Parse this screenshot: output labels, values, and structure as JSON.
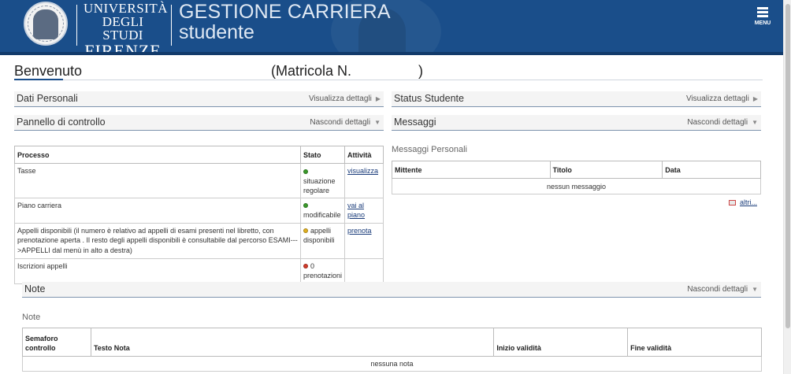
{
  "header": {
    "university_line1": "UNIVERSITÀ",
    "university_line2": "DEGLI STUDI",
    "university_line3": "FIRENZE",
    "app_title_line1": "GESTIONE CARRIERA",
    "app_title_line2": "studente",
    "menu_label": "MENU",
    "seal_text": "FLORENTINA STUDIORUM UNIVERSITAS",
    "colors": {
      "header_bg": "#1a4e8a",
      "text": "#ffffff"
    }
  },
  "welcome": {
    "greeting": "Benvenuto",
    "matricola": "(Matricola N.                 )"
  },
  "sections": {
    "dati_personali": {
      "title": "Dati Personali",
      "action": "Visualizza dettagli",
      "caret": "▶"
    },
    "status_studente": {
      "title": "Status Studente",
      "action": "Visualizza dettagli",
      "caret": "▶"
    },
    "pannello": {
      "title": "Pannello di controllo",
      "action": "Nascondi dettagli",
      "caret": "▼"
    },
    "messaggi": {
      "title": "Messaggi",
      "action": "Nascondi dettagli",
      "caret": "▼"
    },
    "note": {
      "title": "Note",
      "action": "Nascondi dettagli",
      "caret": "▼"
    }
  },
  "process_table": {
    "headers": {
      "processo": "Processo",
      "stato": "Stato",
      "attivita": "Attività"
    },
    "rows": [
      {
        "processo": "Tasse",
        "status_color": "green",
        "stato": "situazione regolare",
        "attivita": "visualizza"
      },
      {
        "processo": "Piano carriera",
        "status_color": "green",
        "stato": "modificabile",
        "attivita": "vai al piano"
      },
      {
        "processo": "Appelli disponibili (il numero è relativo ad appelli di esami presenti nel libretto, con prenotazione aperta . Il resto degli appelli disponibili è consultabile dal percorso ESAMI--->APPELLI dal menù in alto a destra)",
        "status_color": "yellow",
        "stato": "appelli disponibili",
        "attivita": "prenota"
      },
      {
        "processo": "Iscrizioni appelli",
        "status_color": "red",
        "stato": "0 prenotazioni",
        "attivita": ""
      }
    ]
  },
  "messages": {
    "heading": "Messaggi Personali",
    "headers": {
      "mittente": "Mittente",
      "titolo": "Titolo",
      "data": "Data"
    },
    "empty": "nessun messaggio",
    "altri": "altri..."
  },
  "notes": {
    "heading": "Note",
    "headers": {
      "semaforo_line1": "Semaforo",
      "semaforo_line2": "controllo",
      "testo": "Testo Nota",
      "inizio": "Inizio validità",
      "fine": "Fine validità"
    },
    "empty": "nessuna nota"
  },
  "status_colors": {
    "green": "#3a9a2a",
    "yellow": "#e0b020",
    "red": "#d23a2a"
  }
}
